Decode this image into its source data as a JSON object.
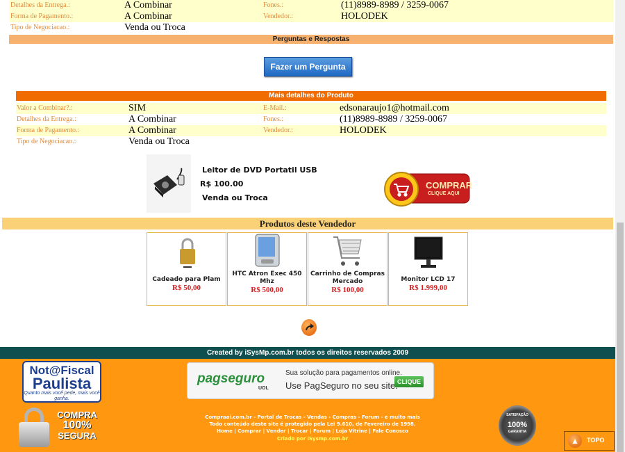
{
  "top_info": {
    "rows": [
      {
        "label": "Detalhes da Entrega.:",
        "value": "A Combinar",
        "label2": "Fones.:",
        "value2": "(11)8989-8989 / 3259-0067"
      },
      {
        "label": "Forma de Pagamento.:",
        "value": "A Combinar",
        "label2": "Vendedor.:",
        "value2": "HOLODEK"
      },
      {
        "label": "Tipo de Negociacao.:",
        "value": "Venda ou Troca",
        "label2": "",
        "value2": ""
      }
    ]
  },
  "qa": {
    "title": "Perguntas e Respostas",
    "ask_button": "Fazer um Pergunta"
  },
  "details": {
    "title": "Mais detalhes do Produto",
    "rows": [
      {
        "label": "Valor a Combinar?.:",
        "value": "SIM",
        "label2": "E-Mail.:",
        "value2": "edsonaraujo1@hotmail.com"
      },
      {
        "label": "Detalhes da Entrega.:",
        "value": "A Combinar",
        "label2": "Fones.:",
        "value2": "(11)8989-8989 / 3259-0067"
      },
      {
        "label": "Forma de Pagamento.:",
        "value": "A Combinar",
        "label2": "Vendedor.:",
        "value2": "HOLODEK"
      },
      {
        "label": "Tipo de Negociacao.:",
        "value": "Venda ou Troca",
        "label2": "",
        "value2": ""
      }
    ]
  },
  "product": {
    "name": "Leitor de DVD Portatil USB",
    "price": "R$  100.00",
    "negotiation": "Venda ou Troca",
    "buy_main": "COMPRAR",
    "buy_sub": "CLIQUE AQUI"
  },
  "seller_products": {
    "title": "Produtos deste Vendedor",
    "items": [
      {
        "name": "Cadeado para Plam",
        "price": "R$ 50,00",
        "icon": "padlock-icon"
      },
      {
        "name": "HTC Atron Exec 450 Mhz",
        "price": "R$ 500,00",
        "icon": "pda-icon"
      },
      {
        "name": "Carrinho de Compras Mercado",
        "price": "R$ 100,00",
        "icon": "shopping-cart-icon"
      },
      {
        "name": "Monitor LCD 17",
        "price": "R$ 1.999,00",
        "icon": "monitor-icon"
      }
    ]
  },
  "footer": {
    "copyright": "Created by iSysMp.com.br todos os direitos reservados 2009",
    "nfp_line1": "Not@Fiscal",
    "nfp_line2": "Paulista",
    "nfp_line3": "Quanto mais você pede, mais você ganha.",
    "compra_line1": "COMPRA",
    "compra_line2": "100%",
    "compra_line3": "SEGURA",
    "pagseguro_logo": "pagseguro",
    "pagseguro_uol": "UOL",
    "pagseguro_line1": "Sua solução para pagamentos online.",
    "pagseguro_line2": "Use PagSeguro no seu site.",
    "pagseguro_button": "CLIQUE",
    "text_line1": "Compraai.com.br - Portal de Trocas - Vendas - Compras - Forum - e muito mais",
    "text_line2": "Todo conteúdo deste site é protegido pela Lei 9.610, de Fevereiro de 1998.",
    "links": "Home | Comprar | Vender | Trocar | Forum | Loja Vitrine | Fale Conosco",
    "credit": "Criado por iSysmp.com.br",
    "seal_top": "SATISFAÇÃO",
    "seal_mid": "100%",
    "seal_bottom": "GARANTIA",
    "topo": "TOPO"
  },
  "colors": {
    "accent_orange": "#ff9810",
    "header_red": "#f06b00",
    "price_red": "#d32020",
    "footer_dark": "#0f4f4f"
  }
}
